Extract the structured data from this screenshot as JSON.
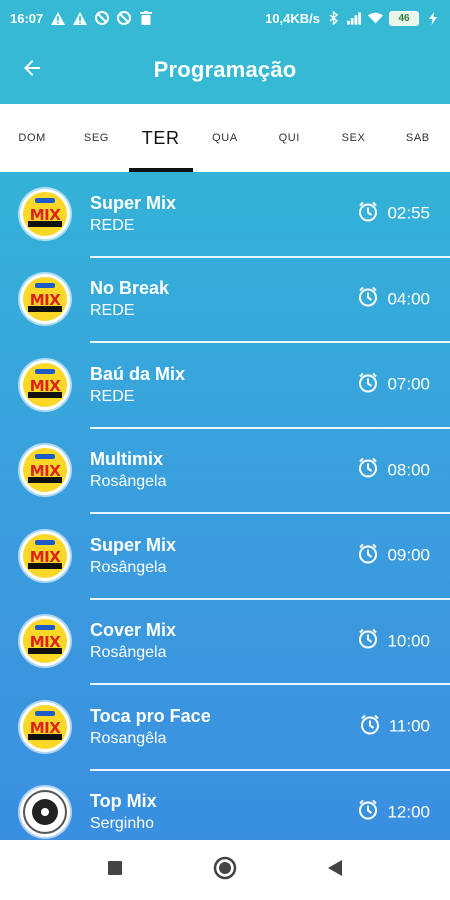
{
  "status_bar": {
    "time": "16:07",
    "network_speed": "10,4KB/s",
    "battery": "46"
  },
  "app_bar": {
    "title": "Programação",
    "back_icon": "arrow-left-icon"
  },
  "tabs": [
    {
      "label": "DOM",
      "active": false
    },
    {
      "label": "SEG",
      "active": false
    },
    {
      "label": "TER",
      "active": true
    },
    {
      "label": "QUA",
      "active": false
    },
    {
      "label": "QUI",
      "active": false
    },
    {
      "label": "SEX",
      "active": false
    },
    {
      "label": "SAB",
      "active": false
    }
  ],
  "programs": [
    {
      "name": "Super Mix",
      "host": "REDE",
      "time": "02:55",
      "logo": "mix-logo"
    },
    {
      "name": "No Break",
      "host": "REDE",
      "time": "04:00",
      "logo": "mix-logo"
    },
    {
      "name": "Baú da Mix",
      "host": "REDE",
      "time": "07:00",
      "logo": "mix-logo"
    },
    {
      "name": "Multimix",
      "host": "Rosângela",
      "time": "08:00",
      "logo": "mix-logo"
    },
    {
      "name": "Super Mix",
      "host": "Rosângela",
      "time": "09:00",
      "logo": "mix-logo"
    },
    {
      "name": "Cover Mix",
      "host": "Rosângela",
      "time": "10:00",
      "logo": "mix-logo"
    },
    {
      "name": "Toca pro Face",
      "host": "Rosangêla",
      "time": "11:00",
      "logo": "mix-logo"
    },
    {
      "name": "Top Mix",
      "host": "Serginho",
      "time": "12:00",
      "logo": "disc-logo"
    }
  ],
  "colors": {
    "accent": "#35b9d4",
    "list_top": "#33b2d8",
    "list_bottom": "#3a8fe0"
  },
  "nav_bar": {
    "items": [
      "recents-square-icon",
      "home-circle-icon",
      "back-triangle-icon"
    ]
  }
}
